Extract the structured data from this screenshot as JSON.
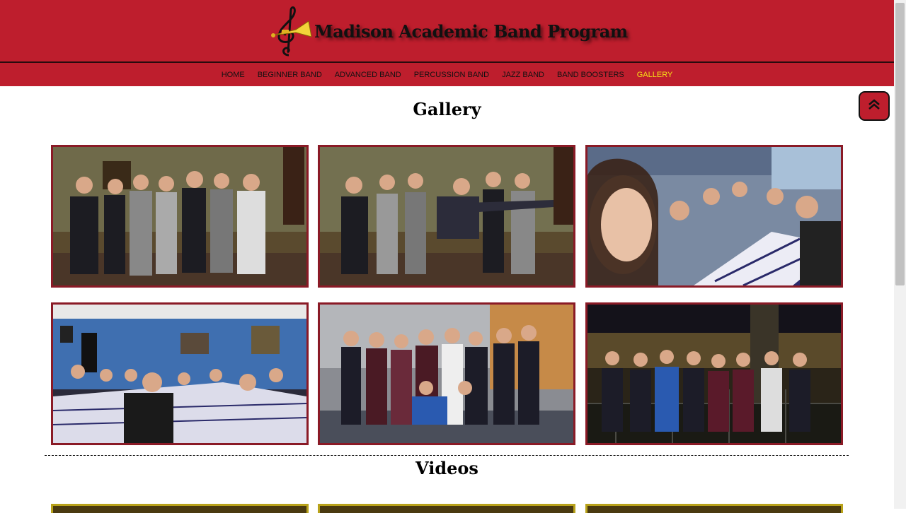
{
  "header": {
    "site_title": "Madison Academic Band Program",
    "logo_icon": "trumpet-treble-clef-logo"
  },
  "nav": {
    "items": [
      {
        "label": "HOME"
      },
      {
        "label": "BEGINNER BAND"
      },
      {
        "label": "ADVANCED BAND"
      },
      {
        "label": "PERCUSSION BAND"
      },
      {
        "label": "JAZZ BAND"
      },
      {
        "label": "BAND BOOSTERS"
      },
      {
        "label": "GALLERY"
      }
    ],
    "active": "GALLERY",
    "active_color": "#f7e017"
  },
  "gallery": {
    "title": "Gallery",
    "photos": [
      {
        "description": "group-photo-museum"
      },
      {
        "description": "group-photo-museum-posing"
      },
      {
        "description": "selfie-restaurant-table"
      },
      {
        "description": "restaurant-blue-walls-group"
      },
      {
        "description": "group-photo-kitchen"
      },
      {
        "description": "group-photo-night-outdoor"
      }
    ]
  },
  "videos": {
    "title": "Videos"
  },
  "colors": {
    "brand_red": "#be1e2d",
    "photo_border": "#8a1a26",
    "video_border": "#b8a21a"
  },
  "scroll_top_icon": "double-chevron-up-icon"
}
